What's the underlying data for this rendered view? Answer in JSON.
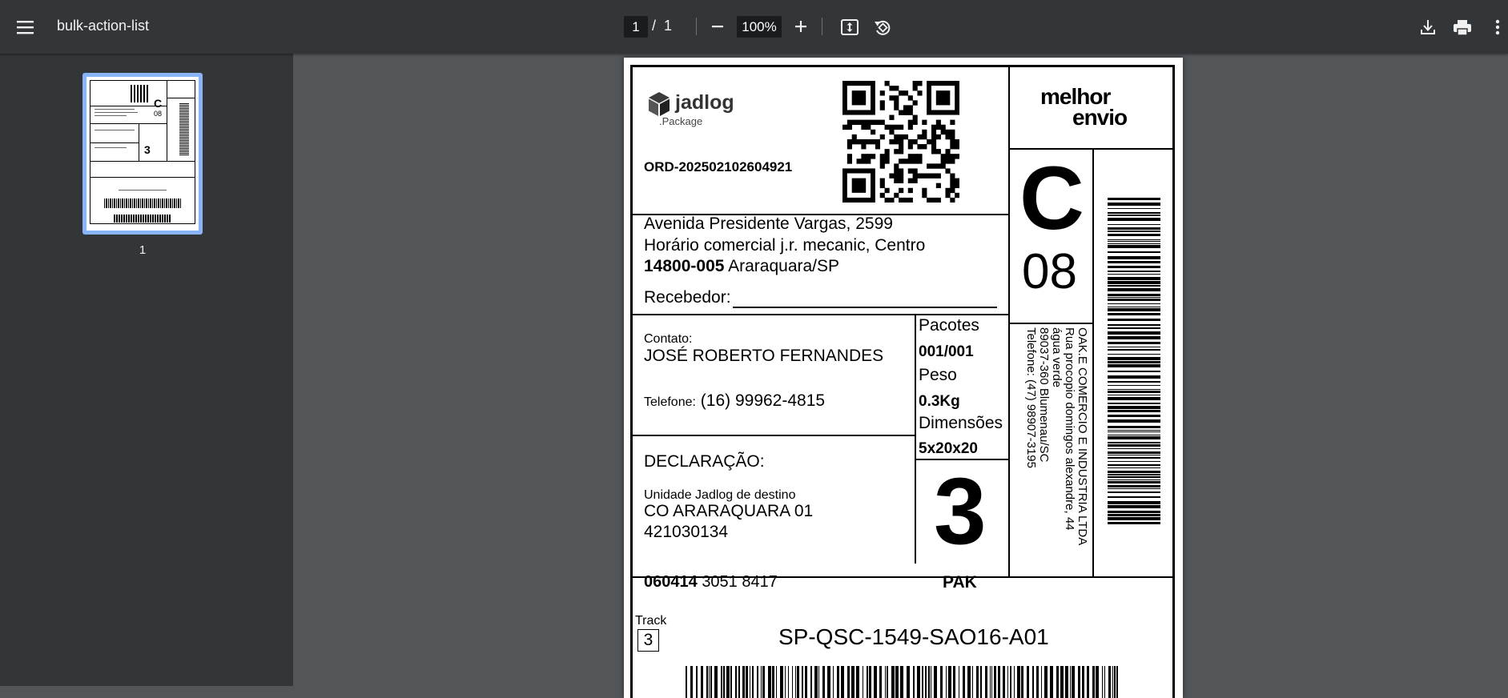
{
  "toolbar": {
    "title": "bulk-action-list",
    "current_page": "1",
    "page_separator": "/",
    "total_pages": "1",
    "zoom": "100%"
  },
  "sidebar": {
    "thumbnail_label": "1"
  },
  "label": {
    "carrier": "jadlog",
    "carrier_sub": ".Package",
    "order_id": "ORD-202502102604921",
    "brand_line1": "melhor",
    "brand_line2": "envio",
    "address_line1": "Avenida Presidente Vargas, 2599",
    "address_line2": "Horário comercial j.r. mecanic, Centro",
    "zip": "14800-005",
    "city": "Araraquara/SP",
    "receiver_label": "Recebedor:",
    "route_letter": "C",
    "route_number": "08",
    "contact_label": "Contato:",
    "contact_name": "JOSÉ ROBERTO FERNANDES",
    "phone_label": "Telefone:",
    "phone": "(16) 99962-4815",
    "packages_label": "Pacotes",
    "packages_value": "001/001",
    "weight_label": "Peso",
    "weight_value": "0.3Kg",
    "dimensions_label": "Dimensões",
    "dimensions_value": "5x20x20",
    "big_number": "3",
    "declaration_label": "DECLARAÇÃO:",
    "dest_unit_label": "Unidade Jadlog de destino",
    "dest_unit_name": "CO ARARAQUARA 01",
    "dest_unit_code": "421030134",
    "sender_name": "OAK.E COMERCIO E INDUSTRIA LTDA",
    "sender_street": "Rua procopio domingos alexandre, 44",
    "sender_district": "água verde",
    "sender_city": "89037-360 Blumenau/SC",
    "sender_phone": "Telefone: (47) 98907-3195",
    "code_bold": "060414",
    "code_rest": "3051 8417",
    "service": "PAK",
    "track_label": "Track",
    "track_digit": "3",
    "route_code": "SP-QSC-1549-SAO16-A01"
  },
  "icons": {
    "menu": "menu-icon",
    "zoom_out": "minus-icon",
    "zoom_in": "plus-icon",
    "fit": "fit-page-icon",
    "rotate": "rotate-icon",
    "download": "download-icon",
    "print": "print-icon",
    "more": "more-vertical-icon"
  },
  "colors": {
    "toolbar_bg": "#323639",
    "viewer_bg": "#525659",
    "thumbnail_selected": "#8ab4f8"
  }
}
